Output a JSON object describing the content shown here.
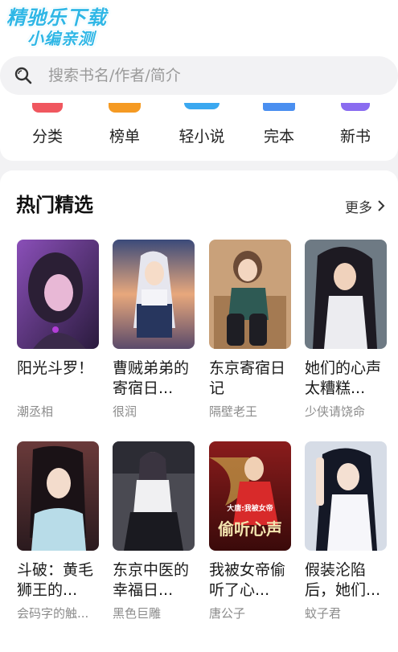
{
  "watermark": {
    "line1": "精驰乐下载",
    "line2": "小编亲测"
  },
  "search": {
    "placeholder": "搜索书名/作者/简介"
  },
  "categories": [
    {
      "label": "分类",
      "icon": "category-icon",
      "color": "#f0575f"
    },
    {
      "label": "榜单",
      "icon": "ranking-icon",
      "color": "#f59a23"
    },
    {
      "label": "轻小说",
      "icon": "light-novel-icon",
      "color": "#3aa8f0"
    },
    {
      "label": "完本",
      "icon": "completed-book-icon",
      "color": "#4a8ff0"
    },
    {
      "label": "新书",
      "icon": "new-book-icon",
      "color": "#8a6cf0"
    }
  ],
  "hot": {
    "title": "热门精选",
    "more_label": "更多",
    "books": [
      {
        "title": "阳光斗罗！",
        "author": "潮丞相"
      },
      {
        "title": "曹贼弟弟的寄宿日...",
        "author": "很润"
      },
      {
        "title": "东京寄宿日记",
        "author": "隔壁老王"
      },
      {
        "title": "她们的心声太糟糕...",
        "author": "少侠请饶命"
      },
      {
        "title": "斗破：黄毛狮王的...",
        "author": "会码字的触..."
      },
      {
        "title": "东京中医的幸福日...",
        "author": "黑色巨雕"
      },
      {
        "title": "我被女帝偷听了心...",
        "author": "唐公子"
      },
      {
        "title": "假装沦陷后，她们...",
        "author": "蚊子君"
      }
    ]
  },
  "cover_text": {
    "title": "偷听心声",
    "subtitle": "大唐:我被女帝"
  }
}
